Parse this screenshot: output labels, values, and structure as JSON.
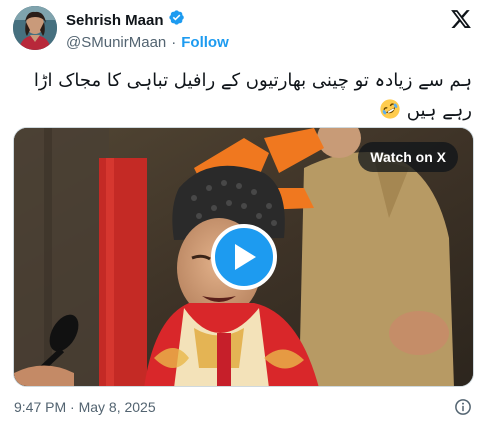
{
  "author": {
    "display_name": "Sehrish Maan",
    "handle": "@SMunirMaan",
    "separator": "·",
    "follow_label": "Follow",
    "verified_color": "#1d9bf0"
  },
  "tweet": {
    "text": "ہم سے زیادہ تو چینی بھارتیوں کے رافیل تباہی کا مجاک اڑا رہے ہیں",
    "emoji": "rolling-on-the-floor-laughing-icon"
  },
  "media": {
    "type": "video",
    "watch_label": "Watch on X",
    "play_icon": "play-icon"
  },
  "footer": {
    "timestamp": "9:47 PM · May 8, 2025",
    "info_icon": "info-icon"
  },
  "colors": {
    "accent": "#1d9bf0",
    "text_primary": "#0f1419",
    "text_secondary": "#536471",
    "border": "#cfd9de"
  }
}
